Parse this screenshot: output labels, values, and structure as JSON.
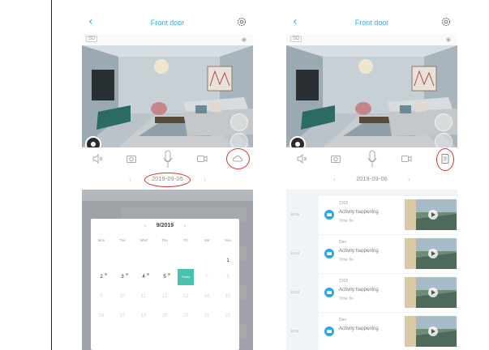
{
  "screens": [
    {
      "header": {
        "back_glyph": "‹",
        "title": "Front door",
        "settings_icon": "gear-icon"
      },
      "stream": {
        "quality_badge": "SD",
        "privacy_icon": "eye-icon"
      },
      "toolbar": {
        "icons": [
          "mute-icon",
          "snapshot-icon",
          "microphone-icon",
          "record-icon",
          "cloud-icon"
        ],
        "highlighted": "cloud-icon"
      },
      "date_bar": {
        "prev_glyph": "‹",
        "date": "2019-09-06",
        "next_glyph": "›",
        "highlighted": true
      },
      "calendar": {
        "month_label": "9/2019",
        "prev_glyph": "‹",
        "next_glyph": "›",
        "weekdays": [
          "Mon",
          "Tue",
          "Wed",
          "Thu",
          "Fri",
          "Sat",
          "Sun"
        ],
        "rows": [
          [
            "",
            "",
            "",
            "",
            "",
            "",
            "1"
          ],
          [
            "2",
            "3",
            "4",
            "5",
            "Today",
            "7",
            "8"
          ],
          [
            "9",
            "10",
            "11",
            "12",
            "13",
            "14",
            "15"
          ],
          [
            "16",
            "17",
            "18",
            "19",
            "20",
            "21",
            "22"
          ]
        ],
        "event_days": [
          "2",
          "3",
          "4",
          "5"
        ],
        "today_label": "Today",
        "accent_color": "#46c2ae",
        "event_dot_color": "#f0a23a"
      }
    },
    {
      "header": {
        "back_glyph": "‹",
        "title": "Front door",
        "settings_icon": "gear-icon"
      },
      "stream": {
        "quality_badge": "SD",
        "privacy_icon": "eye-icon"
      },
      "toolbar": {
        "icons": [
          "mute-icon",
          "snapshot-icon",
          "microphone-icon",
          "record-icon",
          "playback-icon"
        ],
        "highlighted": "playback-icon"
      },
      "date_bar": {
        "prev_glyph": "‹",
        "date": "2019-09-06",
        "next_glyph": "›"
      },
      "events": [
        {
          "time": "10:16",
          "name": "2102",
          "activity": "Activity happening",
          "sub": "Time 8s"
        },
        {
          "time": "10:14",
          "name": "Dev",
          "activity": "Activity happening",
          "sub": "Time 8s"
        },
        {
          "time": "10:13",
          "name": "2102",
          "activity": "Activity happening",
          "sub": "Time 8s"
        },
        {
          "time": "10:11",
          "name": "Dev",
          "activity": "Activity happening",
          "sub": ""
        }
      ]
    }
  ],
  "colors": {
    "accent": "#2ea9e0",
    "highlight_ring": "#d8332c",
    "badge": "#2ea3e6"
  }
}
